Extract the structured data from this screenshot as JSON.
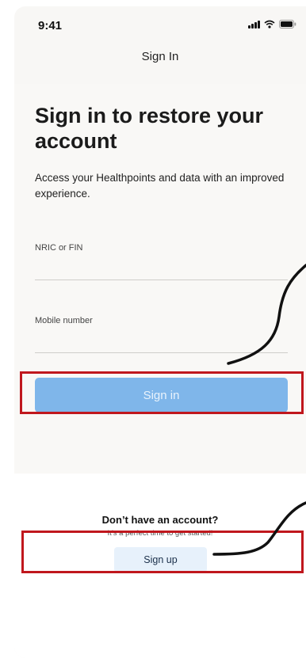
{
  "status_bar": {
    "time": "9:41"
  },
  "nav": {
    "title": "Sign In"
  },
  "headline": "Sign in to restore your account",
  "subtitle": "Access your Healthpoints and data with an improved experience.",
  "form": {
    "nric_label": "NRIC or FIN",
    "nric_value": "",
    "mobile_label": "Mobile number",
    "mobile_value": "",
    "signin_label": "Sign in"
  },
  "signup": {
    "title": "Don’t have an account?",
    "subtitle": "It’s a perfect time to get started!",
    "button_label": "Sign up"
  },
  "colors": {
    "primary_button": "#7fb6ea",
    "secondary_button": "#e7f1fb",
    "annotation": "#c0171d"
  }
}
